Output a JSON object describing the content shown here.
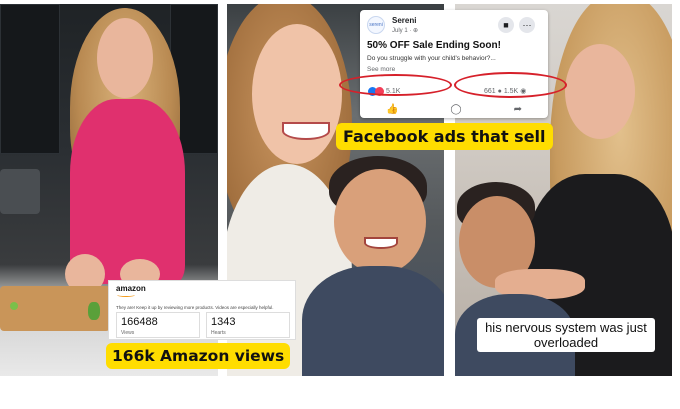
{
  "facebook_card": {
    "page_name": "Sereni",
    "logo_text": "sereni",
    "date": "July 1 · ",
    "headline": "50% OFF Sale Ending Soon!",
    "body": "Do you struggle with your child's behavior?...",
    "see_more": "See more",
    "reactions": "5.1K",
    "comments": "661",
    "views": "1.5K"
  },
  "captions": {
    "facebook": "Facebook ads that sell",
    "amazon": "166k Amazon views",
    "subtitle": "his nervous system was just overloaded"
  },
  "amazon_card": {
    "logo": "amazon",
    "message": "They are! Keep it up by reviewing more products. Videos are especially helpful.",
    "views_value": "166488",
    "views_label": "Views",
    "hearts_value": "1343",
    "hearts_label": "Hearts"
  },
  "colors": {
    "caption_yellow": "#ffdd00",
    "highlight_red": "#d6202a",
    "facebook_blue": "#1877f2"
  },
  "icons": [
    "like-icon",
    "comment-icon",
    "share-icon",
    "messenger-icon",
    "more-icon",
    "eye-icon"
  ]
}
